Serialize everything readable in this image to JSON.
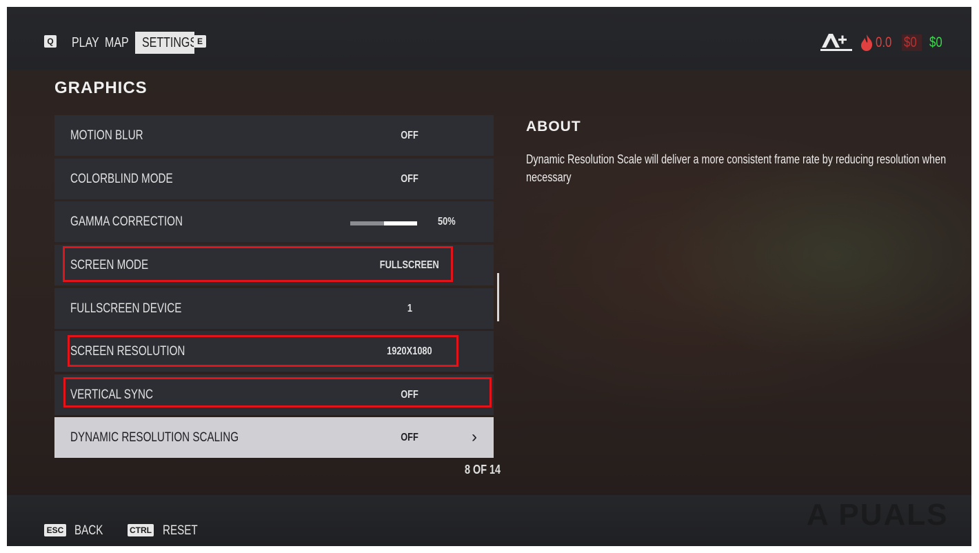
{
  "nav": {
    "left_key": "Q",
    "tabs": [
      {
        "label": "PLAY"
      },
      {
        "label": "MAP"
      },
      {
        "label": "SETTINGS",
        "active": true
      }
    ],
    "right_key": "E"
  },
  "hud": {
    "rank_icon": "a-plus-rank-icon",
    "heat_icon": "flame-icon",
    "heat_value": "0.0",
    "bank_value": "$0",
    "cash_value": "$0"
  },
  "section_title": "GRAPHICS",
  "settings": [
    {
      "label": "MOTION BLUR",
      "value": "OFF"
    },
    {
      "label": "COLORBLIND MODE",
      "value": "OFF"
    },
    {
      "label": "GAMMA CORRECTION",
      "value": "50%",
      "slider_level": 0.5
    },
    {
      "label": "SCREEN MODE",
      "value": "FULLSCREEN"
    },
    {
      "label": "FULLSCREEN DEVICE",
      "value": "1"
    },
    {
      "label": "SCREEN RESOLUTION",
      "value": "1920X1080"
    },
    {
      "label": "VERTICAL SYNC",
      "value": "OFF"
    },
    {
      "label": "DYNAMIC RESOLUTION SCALING",
      "value": "OFF",
      "selected": true
    }
  ],
  "pager": "8 OF 14",
  "about": {
    "title": "ABOUT",
    "text": "Dynamic Resolution Scale will deliver a more consistent frame rate by reducing resolution when necessary"
  },
  "footer": {
    "back_key": "ESC",
    "back_label": "BACK",
    "reset_key": "CTRL",
    "reset_label": "RESET"
  },
  "watermark": "A PUALS",
  "colors": {
    "highlight_box": "#e2141a",
    "heat": "#e0403f",
    "bank": "#b83232",
    "cash": "#3fd64f"
  }
}
